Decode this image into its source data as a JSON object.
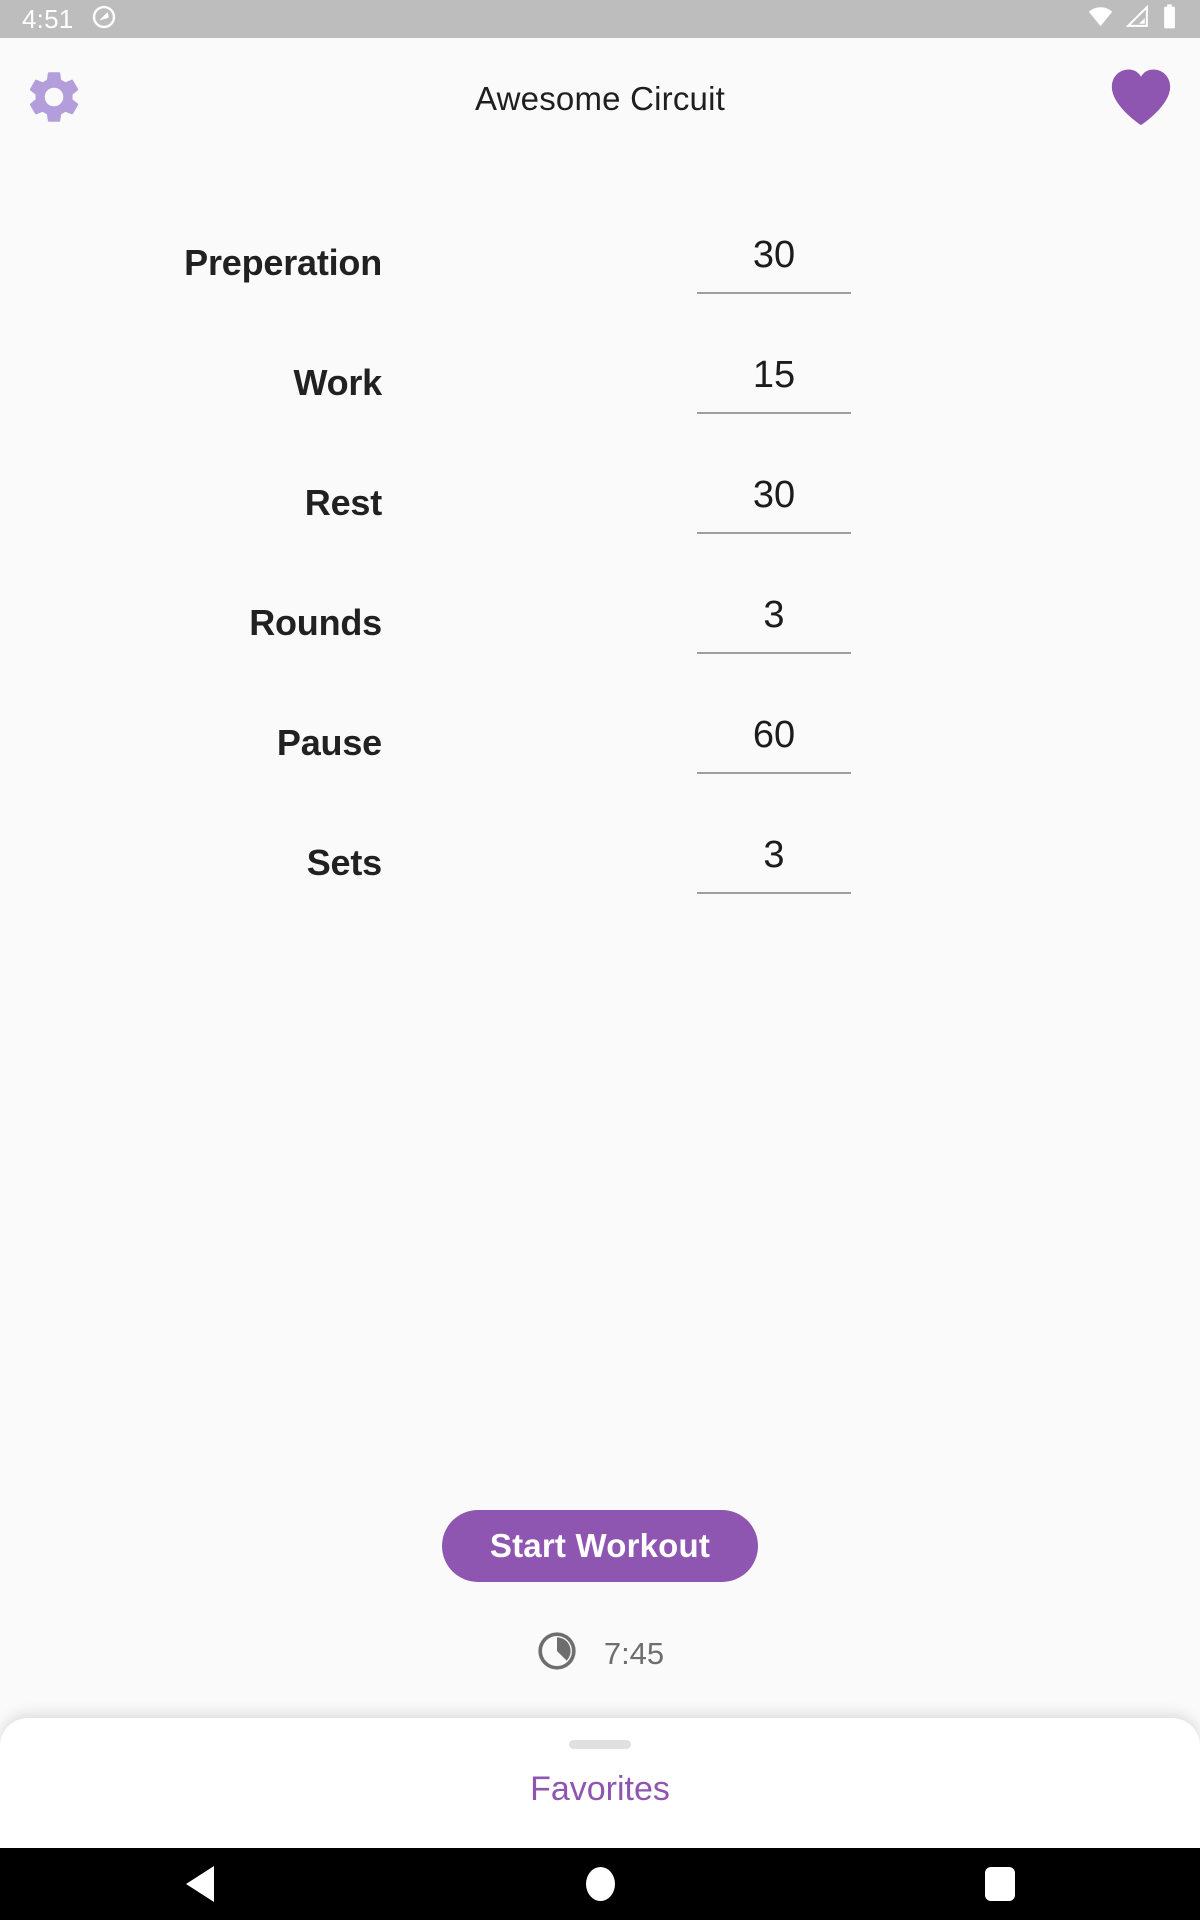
{
  "status_bar": {
    "time": "4:51",
    "notification_icon": "android-q-logo-icon",
    "wifi_icon": "wifi-icon",
    "cellular_icon": "cellular-signal-icon",
    "battery_icon": "battery-full-icon",
    "background_color": "#BDBDBD"
  },
  "app_bar": {
    "title": "Awesome Circuit",
    "settings_icon": "gear-icon",
    "settings_icon_color": "#B39DDB",
    "favorite_icon": "heart-icon",
    "favorite_icon_color": "#8E56B0"
  },
  "settings": {
    "rows": [
      {
        "label": "Preperation",
        "value": "30"
      },
      {
        "label": "Work",
        "value": "15"
      },
      {
        "label": "Rest",
        "value": "30"
      },
      {
        "label": "Rounds",
        "value": "3"
      },
      {
        "label": "Pause",
        "value": "60"
      },
      {
        "label": "Sets",
        "value": "3"
      }
    ]
  },
  "actions": {
    "start_label": "Start Workout",
    "start_button_color": "#8E56B0"
  },
  "total_time": {
    "icon": "timer-pie-icon",
    "value": "7:45"
  },
  "bottom_sheet": {
    "label": "Favorites",
    "label_color": "#8E56B0",
    "drag_handle": "drag-handle"
  },
  "nav_bar": {
    "back": "back-triangle-icon",
    "home": "home-circle-icon",
    "recents": "recents-square-icon"
  }
}
